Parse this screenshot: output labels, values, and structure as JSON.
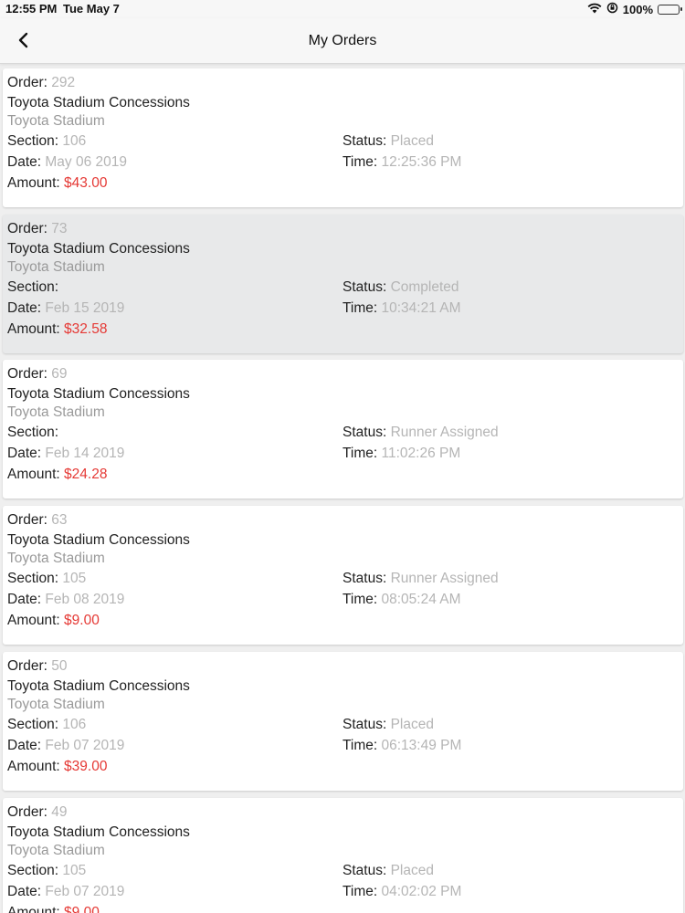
{
  "status_bar": {
    "time": "12:55 PM",
    "date": "Tue May 7",
    "battery": "100%",
    "wifi_icon": "wifi-icon",
    "lock_icon": "orientation-lock-icon",
    "battery_icon": "battery-charging-icon"
  },
  "nav": {
    "title": "My Orders",
    "back_icon": "chevron-left-icon"
  },
  "labels": {
    "order": "Order:",
    "section": "Section:",
    "date": "Date:",
    "amount": "Amount:",
    "status": "Status:",
    "time": "Time:"
  },
  "colors": {
    "amount": "#e53935",
    "value": "#b5b5b5",
    "selected_card": "#e8e9ea"
  },
  "orders": [
    {
      "order": "292",
      "venue": "Toyota Stadium Concessions",
      "location": "Toyota Stadium",
      "section": "106",
      "status": "Placed",
      "date": "May 06 2019",
      "time": "12:25:36 PM",
      "amount": "$43.00",
      "selected": false
    },
    {
      "order": "73",
      "venue": "Toyota Stadium Concessions",
      "location": "Toyota Stadium",
      "section": "",
      "status": "Completed",
      "date": "Feb 15 2019",
      "time": "10:34:21 AM",
      "amount": "$32.58",
      "selected": true
    },
    {
      "order": "69",
      "venue": "Toyota Stadium Concessions",
      "location": "Toyota Stadium",
      "section": "",
      "status": "Runner Assigned",
      "date": "Feb 14 2019",
      "time": "11:02:26 PM",
      "amount": "$24.28",
      "selected": false
    },
    {
      "order": "63",
      "venue": "Toyota Stadium Concessions",
      "location": "Toyota Stadium",
      "section": "105",
      "status": "Runner Assigned",
      "date": "Feb 08 2019",
      "time": "08:05:24 AM",
      "amount": "$9.00",
      "selected": false
    },
    {
      "order": "50",
      "venue": "Toyota Stadium Concessions",
      "location": "Toyota Stadium",
      "section": "106",
      "status": "Placed",
      "date": "Feb 07 2019",
      "time": "06:13:49 PM",
      "amount": "$39.00",
      "selected": false
    },
    {
      "order": "49",
      "venue": "Toyota Stadium Concessions",
      "location": "Toyota Stadium",
      "section": "105",
      "status": "Placed",
      "date": "Feb 07 2019",
      "time": "04:02:02 PM",
      "amount": "$9.00",
      "selected": false
    }
  ]
}
